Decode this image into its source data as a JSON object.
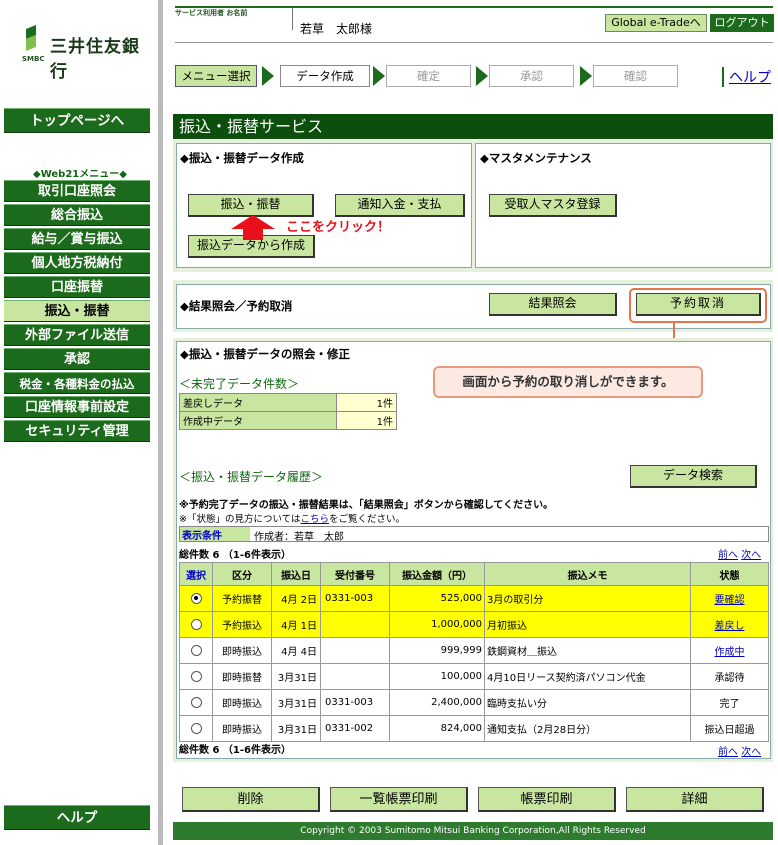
{
  "sidebar": {
    "bank_name": "三井住友銀行",
    "smbc": "SMBC",
    "top_page": "トップページへ",
    "menu_heading": "◆Web21メニュー◆",
    "items": [
      {
        "label": "取引口座照会"
      },
      {
        "label": "総合振込"
      },
      {
        "label": "給与／賞与振込"
      },
      {
        "label": "個人地方税納付"
      },
      {
        "label": "口座振替"
      },
      {
        "label": "振込・振替"
      },
      {
        "label": "外部ファイル送信"
      },
      {
        "label": "承認"
      },
      {
        "label": "税金・各種料金の払込"
      },
      {
        "label": "口座情報事前設定"
      },
      {
        "label": "セキュリティ管理"
      }
    ],
    "help": "ヘルプ"
  },
  "header": {
    "user_label": "サービス利用者 お名前",
    "user_name": "若草　太郎様",
    "global_btn": "Global e-Tradeへ",
    "logout_btn": "ログアウト",
    "help_link": "ヘルプ"
  },
  "steps": [
    "メニュー選択",
    "データ作成",
    "確定",
    "承認",
    "確認"
  ],
  "title": "振込・振替サービス",
  "create": {
    "title": "◆振込・振替データ作成",
    "btn_transfer": "振込・振替",
    "btn_notice": "通知入金・支払",
    "btn_from_data": "振込データから作成",
    "click_here": "ここをクリック！"
  },
  "master": {
    "title": "◆マスタメンテナンス",
    "btn_payee": "受取人マスタ登録"
  },
  "result": {
    "title": "◆結果照会／予約取消",
    "btn_inquiry": "結果照会",
    "btn_cancel": "予約取消"
  },
  "callout": "画面から予約の取り消しができます。",
  "history": {
    "title": "◆振込・振替データの照会・修正",
    "incomplete_title": "＜未完了データ件数＞",
    "incomplete": [
      {
        "label": "差戻しデータ",
        "count": "1件"
      },
      {
        "label": "作成中データ",
        "count": "1件"
      }
    ],
    "history_title": "＜振込・振替データ履歴＞",
    "btn_search": "データ検索",
    "note1": "※予約完了データの振込・振替結果は、「結果照会」ボタンから確認してください。",
    "note2_pre": "※「状態」の見方については",
    "note2_link": "こちら",
    "note2_post": "をご覧ください。",
    "cond_label": "表示条件",
    "cond_value": "作成者：若草　太郎",
    "total": "総件数 6 （1-6件表示）",
    "prev": "前へ",
    "next": "次へ",
    "headers": [
      "選択",
      "区分",
      "振込日",
      "受付番号",
      "振込金額（円）",
      "振込メモ",
      "状態"
    ],
    "rows": [
      {
        "type": "予約振替",
        "date": "4月 2日",
        "no": "0331-003",
        "amount": "525,000",
        "memo": "3月の取引分",
        "status": "要確認",
        "status_link": true,
        "highlight": true,
        "checked": true
      },
      {
        "type": "予約振込",
        "date": "4月 1日",
        "no": "",
        "amount": "1,000,000",
        "memo": "月初振込",
        "status": "差戻し",
        "status_link": true,
        "highlight": true,
        "checked": false
      },
      {
        "type": "即時振込",
        "date": "4月 4日",
        "no": "",
        "amount": "999,999",
        "memo": "鉄鋼資材＿振込",
        "status": "作成中",
        "status_link": true,
        "highlight": false,
        "checked": false
      },
      {
        "type": "即時振替",
        "date": "3月31日",
        "no": "",
        "amount": "100,000",
        "memo": "4月10日リース契約済パソコン代金",
        "status": "承認待",
        "status_link": false,
        "highlight": false,
        "checked": false
      },
      {
        "type": "即時振込",
        "date": "3月31日",
        "no": "0331-003",
        "amount": "2,400,000",
        "memo": "臨時支払い分",
        "status": "完了",
        "status_link": false,
        "highlight": false,
        "checked": false
      },
      {
        "type": "即時振込",
        "date": "3月31日",
        "no": "0331-002",
        "amount": "824,000",
        "memo": "通知支払（2月28日分）",
        "status": "振込日超過",
        "status_link": false,
        "highlight": false,
        "checked": false
      }
    ]
  },
  "footer": {
    "btn_delete": "削除",
    "btn_list_print": "一覧帳票印刷",
    "btn_print": "帳票印刷",
    "btn_detail": "詳細",
    "copyright": "Copyright © 2003 Sumitomo Mitsui Banking Corporation,All Rights Reserved"
  },
  "colors": {
    "brand_green": "#1c6a1c",
    "light_green": "#c8e6a0",
    "highlight": "#ffff00",
    "callout_red": "#e8101a"
  }
}
